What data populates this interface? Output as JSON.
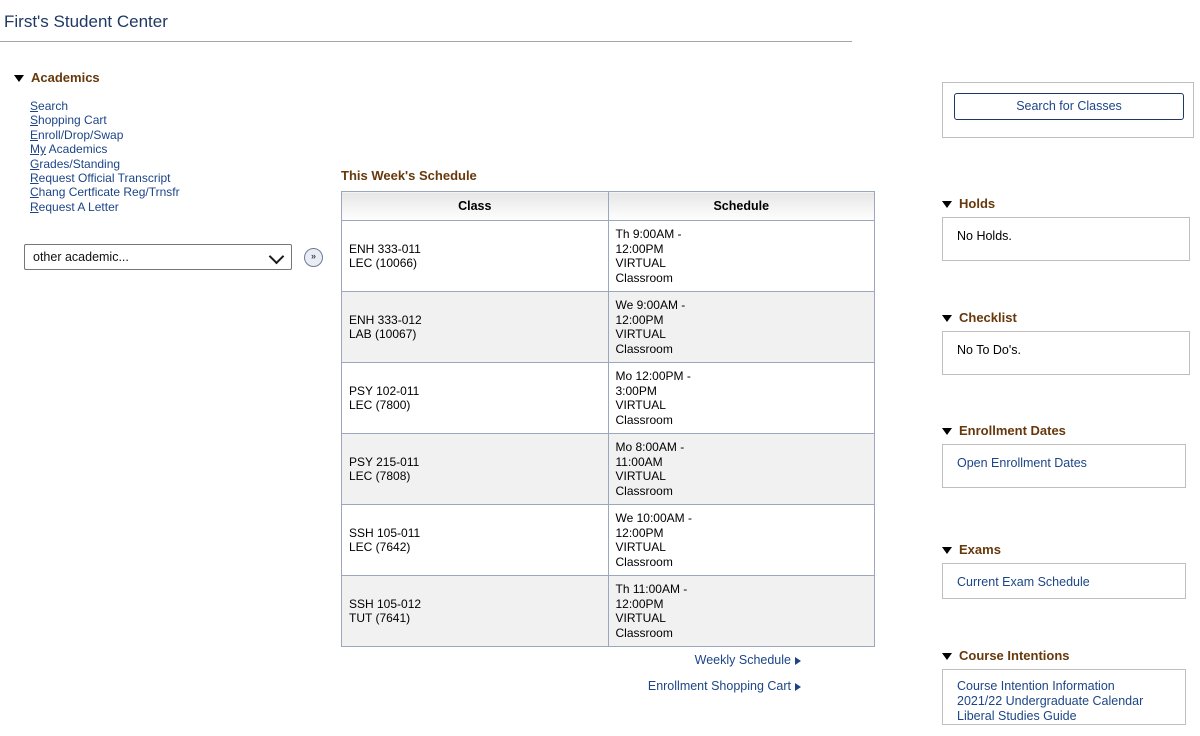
{
  "page": {
    "title": "First's Student Center"
  },
  "academics": {
    "heading": "Academics",
    "links": [
      {
        "accesskey": "S",
        "rest": "earch",
        "full": "Search"
      },
      {
        "accesskey": "S",
        "rest": "hopping Cart",
        "full": "Shopping Cart"
      },
      {
        "accesskey": "E",
        "rest": "nroll/Drop/Swap",
        "full": "Enroll/Drop/Swap"
      },
      {
        "accesskey": "My",
        "rest": " Academics",
        "full": "My Academics"
      },
      {
        "accesskey": "G",
        "rest": "rades/Standing",
        "full": "Grades/Standing"
      },
      {
        "accesskey": "R",
        "rest": "equest Official Transcript",
        "full": "Request Official Transcript"
      },
      {
        "accesskey": "C",
        "rest": "hang Certficate Reg/Trnsfr",
        "full": "Chang Certficate Reg/Trnsfr"
      },
      {
        "accesskey": "R",
        "rest": "equest A Letter",
        "full": "Request A Letter"
      }
    ],
    "other_academic": {
      "selected": "other academic...",
      "go_label": "»"
    }
  },
  "schedule": {
    "title": "This Week's Schedule",
    "columns": [
      "Class",
      "Schedule"
    ],
    "rows": [
      {
        "class_code": "ENH 333-011",
        "class_component": "LEC (10066)",
        "time": "Th 9:00AM -",
        "time2": "12:00PM",
        "location": "VIRTUAL",
        "location2": "Classroom"
      },
      {
        "class_code": "ENH 333-012",
        "class_component": "LAB (10067)",
        "time": "We 9:00AM -",
        "time2": "12:00PM",
        "location": "VIRTUAL",
        "location2": "Classroom"
      },
      {
        "class_code": "PSY 102-011",
        "class_component": "LEC (7800)",
        "time": "Mo 12:00PM -",
        "time2": "3:00PM",
        "location": "VIRTUAL",
        "location2": "Classroom"
      },
      {
        "class_code": "PSY 215-011",
        "class_component": "LEC (7808)",
        "time": "Mo 8:00AM -",
        "time2": "11:00AM",
        "location": "VIRTUAL",
        "location2": "Classroom"
      },
      {
        "class_code": "SSH 105-011",
        "class_component": "LEC (7642)",
        "time": "We 10:00AM -",
        "time2": "12:00PM",
        "location": "VIRTUAL",
        "location2": "Classroom"
      },
      {
        "class_code": "SSH 105-012",
        "class_component": "TUT (7641)",
        "time": "Th 11:00AM -",
        "time2": "12:00PM",
        "location": "VIRTUAL",
        "location2": "Classroom"
      }
    ],
    "footer_links": [
      {
        "label": "Weekly Schedule"
      },
      {
        "label": "Enrollment Shopping Cart"
      }
    ]
  },
  "right": {
    "search_classes_label": "Search for Classes",
    "holds": {
      "heading": "Holds",
      "body": "No Holds."
    },
    "checklist": {
      "heading": "Checklist",
      "body": "No To Do's."
    },
    "enrollment_dates": {
      "heading": "Enrollment Dates",
      "link": "Open Enrollment Dates"
    },
    "exams": {
      "heading": "Exams",
      "link": "Current Exam Schedule"
    },
    "course_intentions": {
      "heading": "Course Intentions",
      "links": [
        "Course Intention Information",
        "2021/22 Undergraduate Calendar",
        "Liberal Studies Guide"
      ]
    }
  },
  "colors": {
    "heading_brown": "#66380c",
    "link_blue": "#1c4587",
    "title_navy": "#1f3864",
    "table_border": "#9aa7bd"
  }
}
